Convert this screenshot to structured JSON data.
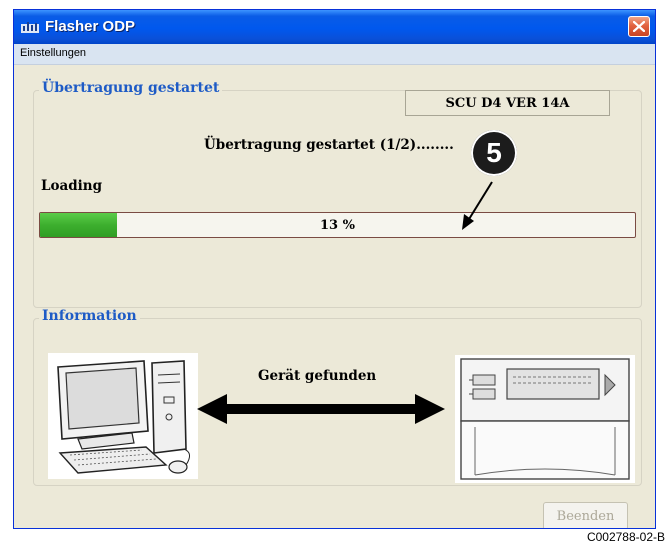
{
  "window": {
    "title": "Flasher ODP",
    "app_icon": "flasher-app-icon",
    "close_icon": "close-icon"
  },
  "menu": {
    "items": [
      "Einstellungen"
    ]
  },
  "transfer": {
    "group_title": "Übertragung gestartet",
    "version": "SCU D4 VER  14A",
    "status": "Übertragung gestartet (1/2)........",
    "loading_label": "Loading",
    "progress_percent": 13,
    "progress_text": "13 %",
    "progress_color": "#3daf2e"
  },
  "callout": {
    "number": "5"
  },
  "information": {
    "group_title": "Information",
    "device_found": "Gerät gefunden",
    "computer_icon": "computer-icon",
    "device_icon": "boiler-device-icon",
    "arrow_icon": "double-arrow-icon"
  },
  "buttons": {
    "quit": "Beenden"
  },
  "caption": "C002788-02-B",
  "colors": {
    "titlebar": "#0058ee",
    "group_title": "#1e5bc6",
    "window_bg": "#ece9d8"
  }
}
